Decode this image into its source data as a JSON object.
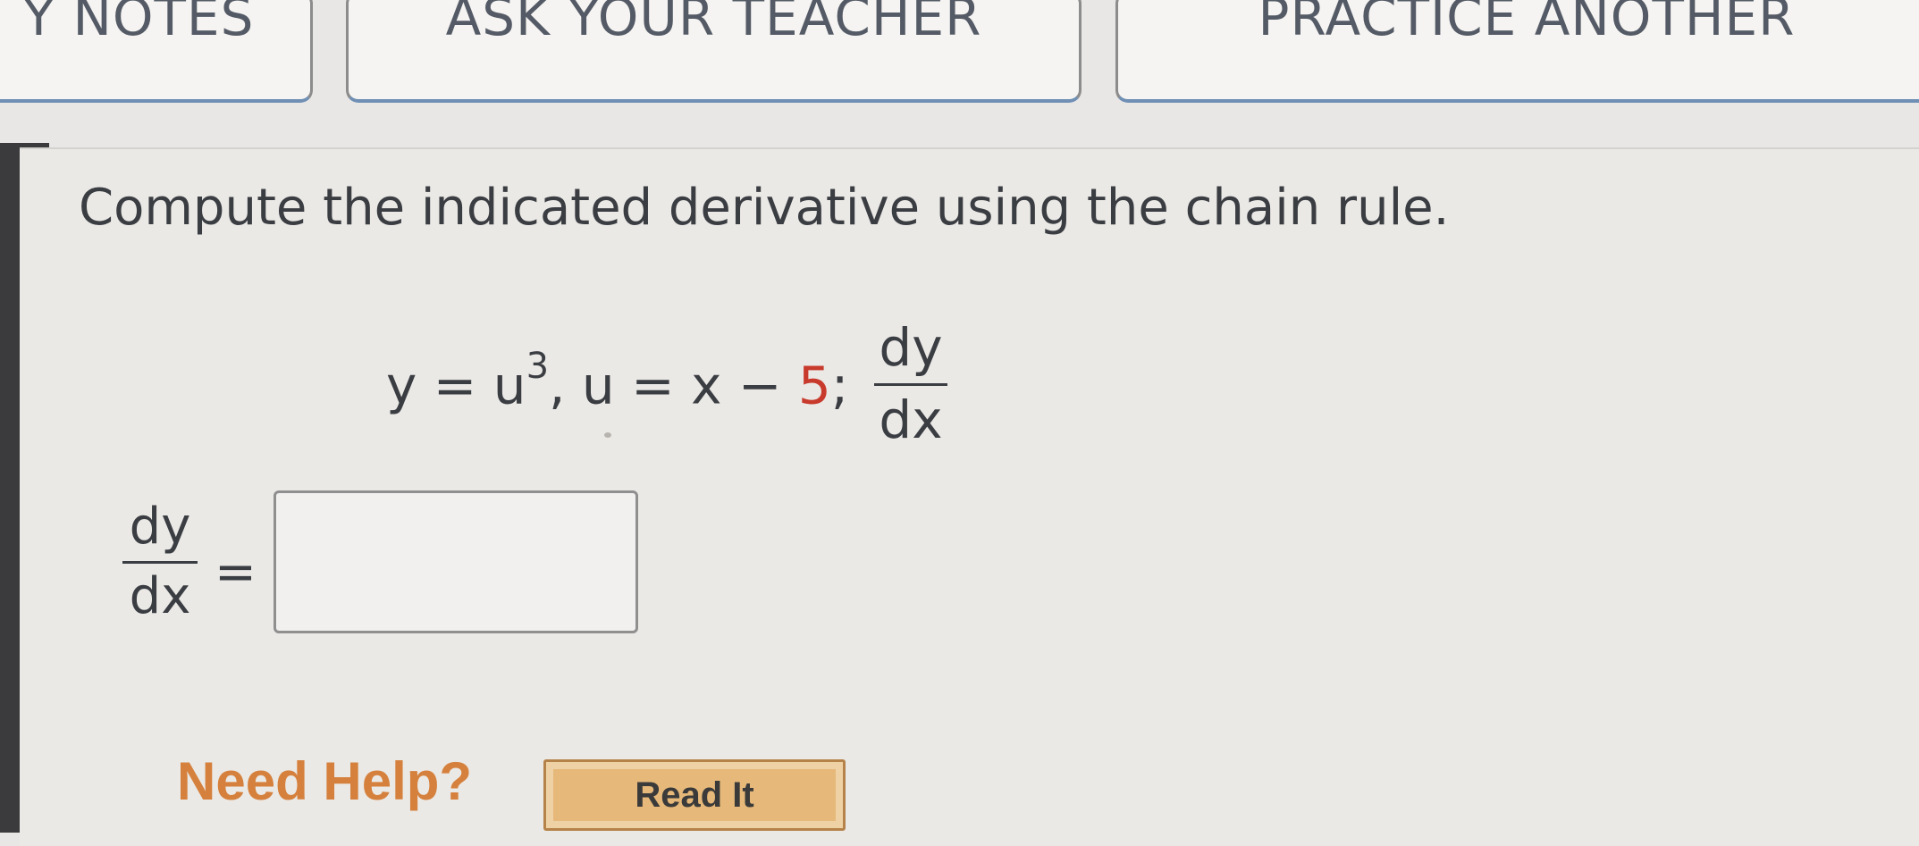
{
  "toolbar": {
    "notes_label": "Y NOTES",
    "ask_label": "ASK YOUR TEACHER",
    "practice_label": "PRACTICE ANOTHER"
  },
  "question": {
    "instruction": "Compute the indicated derivative using the chain rule.",
    "eq_y": "y = u",
    "eq_exp": "3",
    "eq_mid": ", u = x − ",
    "eq_const": "5",
    "eq_semicolon": ";",
    "frac_num": "dy",
    "frac_den": "dx"
  },
  "answer": {
    "lhs_num": "dy",
    "lhs_den": "dx",
    "equals": "=",
    "value": ""
  },
  "help": {
    "label": "Need Help?",
    "read_it": "Read It"
  },
  "colors": {
    "accent": "#d5813d",
    "constant_red": "#c83a2c"
  }
}
